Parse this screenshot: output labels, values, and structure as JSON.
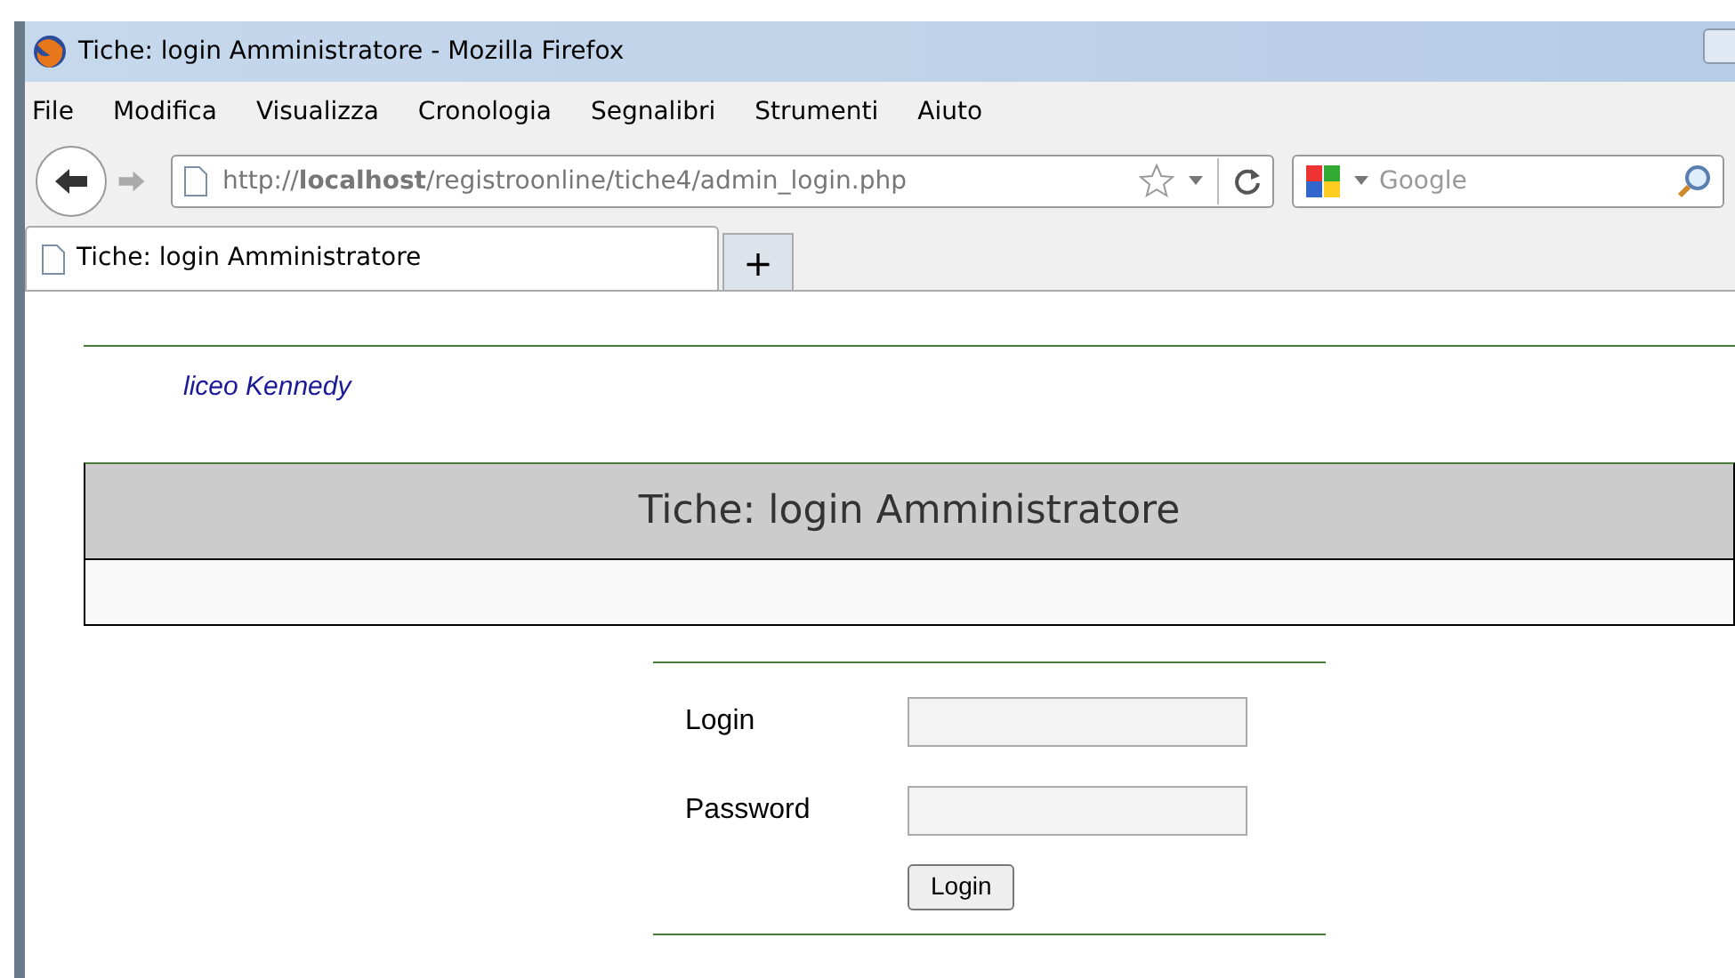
{
  "window": {
    "title": "Tiche: login Amministratore - Mozilla Firefox"
  },
  "menu": [
    "File",
    "Modifica",
    "Visualizza",
    "Cronologia",
    "Segnalibri",
    "Strumenti",
    "Aiuto"
  ],
  "address_bar": {
    "url": "http://**localhost**/registroonline/tiche4/admin_login.php"
  },
  "search": {
    "placeholder": "Google"
  },
  "tabs": [
    {
      "label": "Tiche: login Amministratore",
      "selected": true
    }
  ],
  "new_tab": "+",
  "page": {
    "school": "liceo Kennedy",
    "heading": "Tiche: login Amministratore",
    "fields": [
      {
        "label": "Login"
      },
      {
        "label": "Password"
      }
    ],
    "button": "Login"
  }
}
